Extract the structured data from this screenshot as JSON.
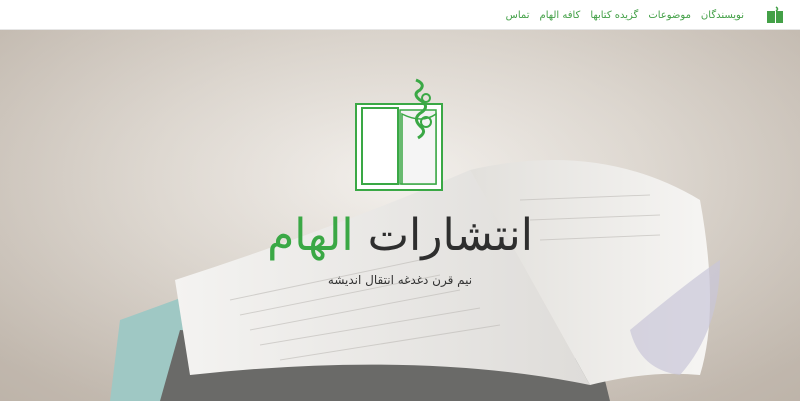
{
  "navbar": {
    "logo_icon": "book-emblem-icon",
    "menu": [
      {
        "label": "نویسندگان"
      },
      {
        "label": "موضوعات"
      },
      {
        "label": "گزیده کتابها"
      },
      {
        "label": "کافه الهام"
      },
      {
        "label": "تماس"
      }
    ]
  },
  "hero": {
    "emblem_icon": "open-book-calligraphy-icon",
    "title_main": "انتشارات",
    "title_accent": "الهام",
    "tagline": "نیم قرن دغدغه انتقال اندیشه",
    "background_image": "open-book-on-table-photo"
  },
  "colors": {
    "accent": "#3aa845",
    "nav_link": "#43a047",
    "title_text": "#2e2e2e"
  }
}
